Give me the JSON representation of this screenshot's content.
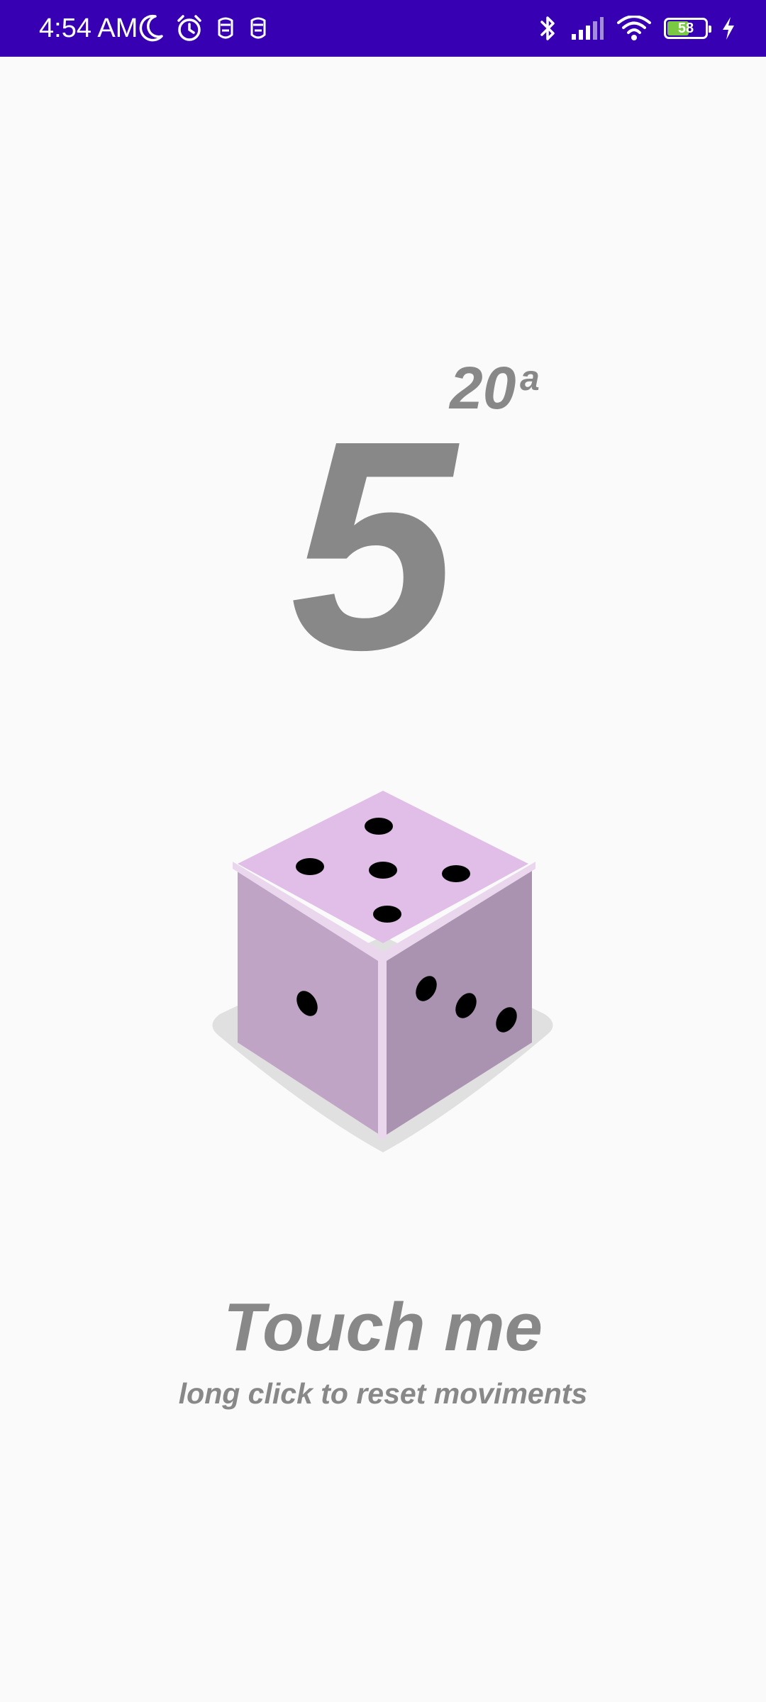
{
  "status_bar": {
    "time": "4:54 AM",
    "left_icons": [
      "moon-icon",
      "alarm-icon",
      "notification-icon",
      "notification-icon"
    ],
    "right_icons": [
      "bluetooth-icon",
      "signal-icon",
      "wifi-icon",
      "battery-icon",
      "charging-icon"
    ],
    "battery_level": "58",
    "battery_fraction": 0.58,
    "background_color": "#3700b3"
  },
  "main": {
    "roll_count": "20",
    "roll_count_suffix": "a",
    "dice_result": "5",
    "dice_top_face_pips": 5,
    "dice_left_face_pips": 1,
    "dice_right_face_pips": 3,
    "dice_colors": {
      "top": "#e1bee7",
      "left": "#c0a4c6",
      "right": "#aa93b1",
      "edge": "#ead7ee",
      "shadow": "#e0e0e0",
      "pip": "#000000"
    },
    "title": "Touch me",
    "subtitle": "long click to reset moviments",
    "text_color": "#888888"
  }
}
